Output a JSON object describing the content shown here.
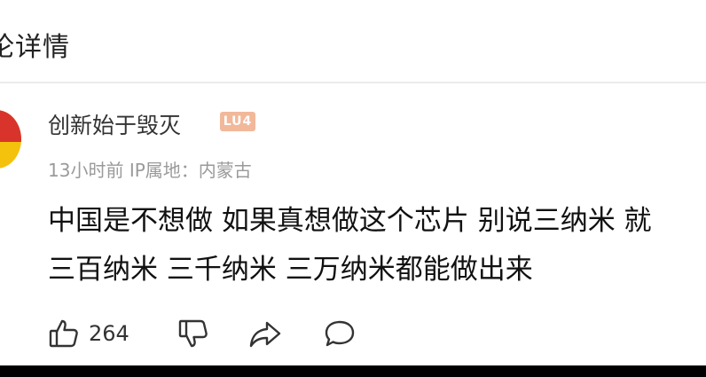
{
  "header": {
    "title": "论详情"
  },
  "comment": {
    "username": "创新始于毁灭",
    "level_badge": "LU4",
    "time": "13小时前",
    "ip_location": "IP属地：内蒙古",
    "content_lines": [
      "中国是不想做 如果真想做这个芯片 别说三纳米 就",
      "三百纳米 三千纳米 三万纳米都能做出来"
    ],
    "like_count": "264"
  },
  "icons": {
    "like": "thumbs-up-icon",
    "dislike": "thumbs-down-icon",
    "share": "share-icon",
    "reply": "comment-icon"
  },
  "colors": {
    "background": "#ffffff",
    "text_primary": "#111111",
    "text_secondary": "#9a9a9a",
    "badge": "#f2b89a",
    "avatar_red": "#d9342b",
    "avatar_yellow": "#f4c20d"
  }
}
